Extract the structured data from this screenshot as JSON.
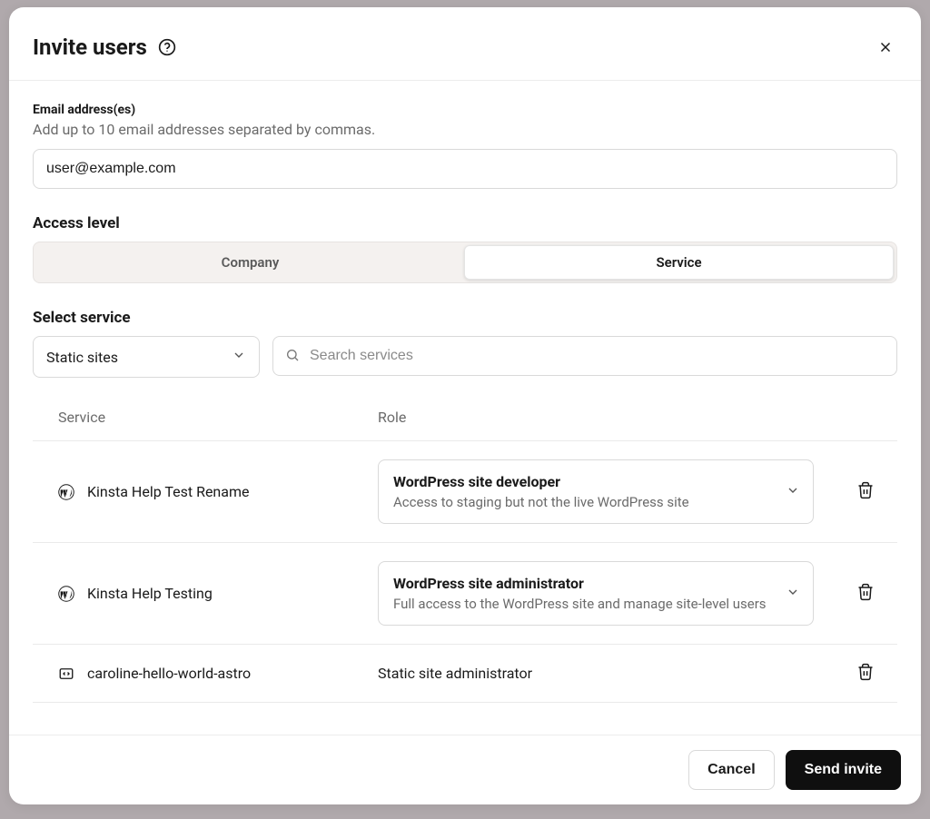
{
  "header": {
    "title": "Invite users"
  },
  "email": {
    "label": "Email address(es)",
    "hint": "Add up to 10 email addresses separated by commas.",
    "value": "user@example.com"
  },
  "access_level": {
    "label": "Access level",
    "tabs": [
      {
        "label": "Company",
        "active": false
      },
      {
        "label": "Service",
        "active": true
      }
    ]
  },
  "service_filter": {
    "label": "Select service",
    "selected": "Static sites",
    "search_placeholder": "Search services"
  },
  "table": {
    "headers": {
      "service": "Service",
      "role": "Role"
    },
    "rows": [
      {
        "icon": "wordpress",
        "name": "Kinsta Help Test Rename",
        "role_title": "WordPress site developer",
        "role_desc": "Access to staging but not the live WordPress site",
        "role_type": "select"
      },
      {
        "icon": "wordpress",
        "name": "Kinsta Help Testing",
        "role_title": "WordPress site administrator",
        "role_desc": "Full access to the WordPress site and manage site-level users",
        "role_type": "select"
      },
      {
        "icon": "static",
        "name": "caroline-hello-world-astro",
        "role_title": "Static site administrator",
        "role_desc": "",
        "role_type": "plain"
      }
    ]
  },
  "footer": {
    "cancel": "Cancel",
    "submit": "Send invite"
  }
}
